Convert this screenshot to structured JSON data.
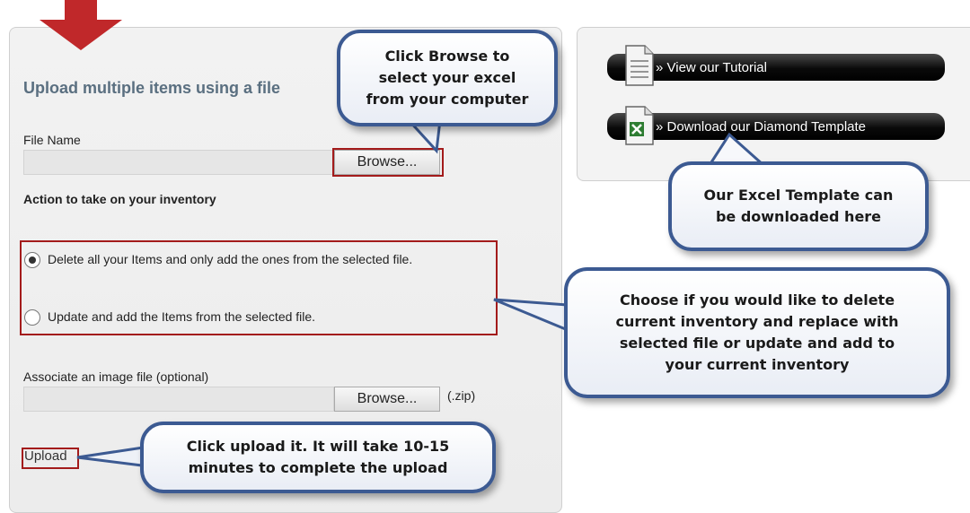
{
  "left_panel": {
    "heading": "Upload multiple items using a file",
    "file_name_label": "File Name",
    "browse_label": "Browse...",
    "action_heading": "Action to take on your inventory",
    "radio_options": [
      {
        "label": "Delete all your Items and only add the ones from the selected file.",
        "selected": true
      },
      {
        "label": "Update and add the Items from the selected file.",
        "selected": false
      }
    ],
    "image_label": "Associate an image file (optional)",
    "image_browse_label": "Browse...",
    "zip_hint": "(.zip)",
    "upload_label": "Upload"
  },
  "right_panel": {
    "tutorial_label": "» View our Tutorial",
    "template_label": "» Download our Diamond Template",
    "tutorial_icon": "document-icon",
    "template_icon": "excel-icon"
  },
  "callouts": {
    "browse": "Click Browse to\nselect your excel\nfrom your computer",
    "template": "Our Excel Template can\nbe downloaded here",
    "choose": "Choose if you would like to delete\ncurrent inventory and replace with\nselected file or update and add to\nyour current inventory",
    "upload": "Click upload it. It will take 10-15\nminutes to complete the upload"
  },
  "colors": {
    "callout_border": "#3c5a92",
    "highlight_box": "#a31b1b",
    "arrow": "#c0282a"
  }
}
